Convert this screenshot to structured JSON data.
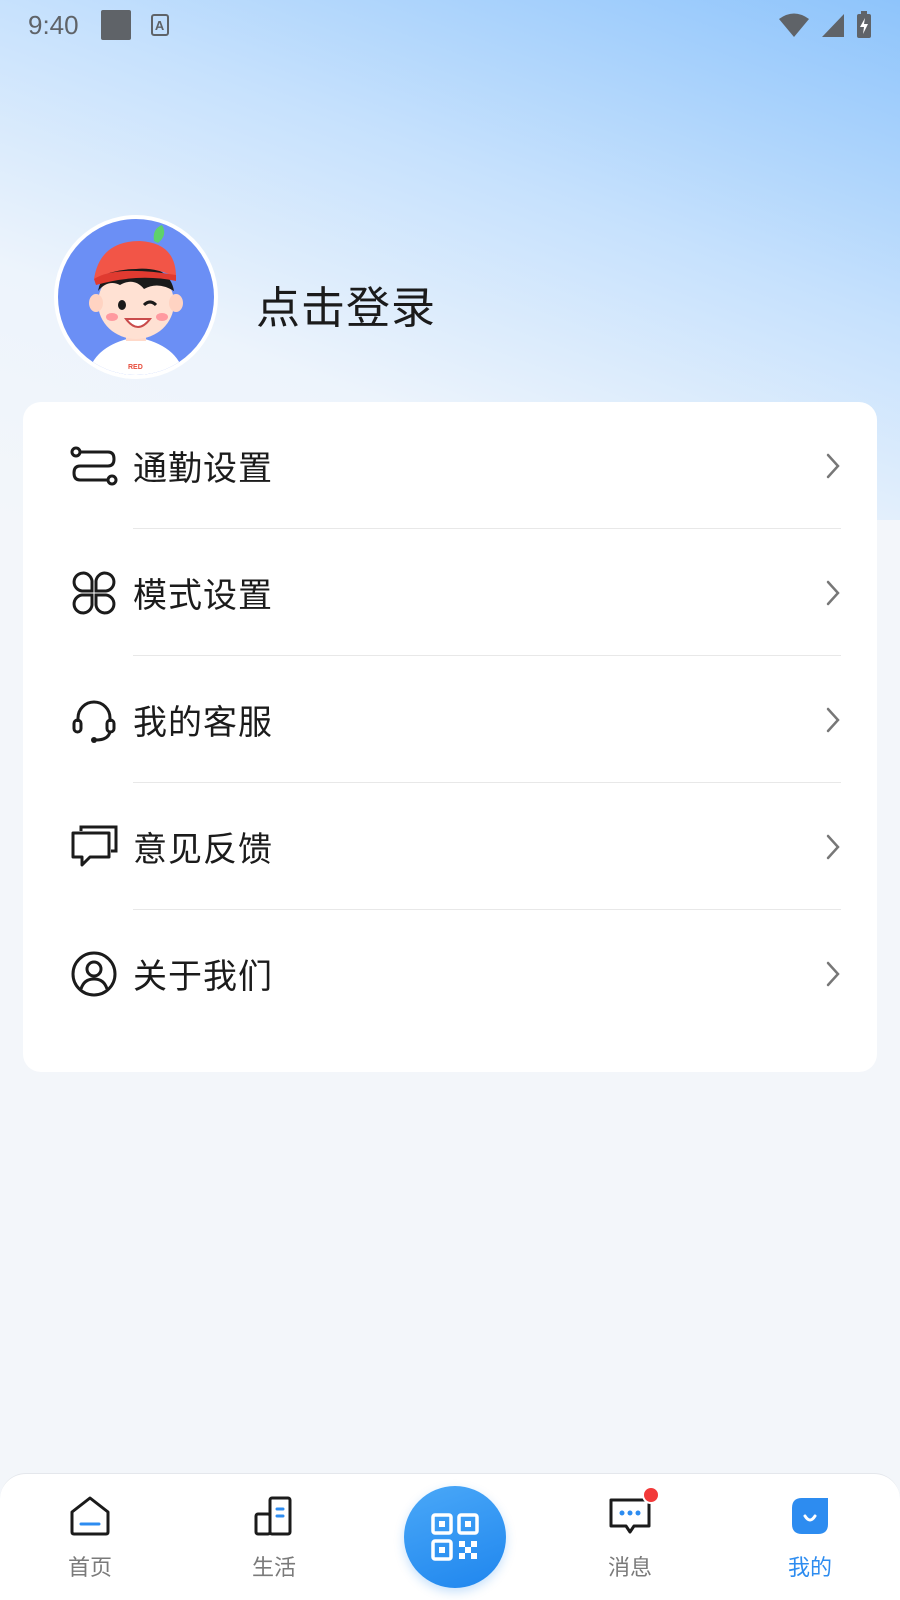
{
  "status_bar": {
    "time": "9:40",
    "indicator_letter": "A"
  },
  "profile": {
    "login_text": "点击登录",
    "avatar_shirt_text": "RED"
  },
  "menu": {
    "items": [
      {
        "label": "通勤设置",
        "icon": "route-icon"
      },
      {
        "label": "模式设置",
        "icon": "mode-grid-icon"
      },
      {
        "label": "我的客服",
        "icon": "headset-icon"
      },
      {
        "label": "意见反馈",
        "icon": "feedback-chat-icon"
      },
      {
        "label": "关于我们",
        "icon": "user-circle-icon"
      }
    ]
  },
  "bottom_nav": {
    "items": [
      {
        "label": "首页",
        "icon": "home-icon",
        "active": false
      },
      {
        "label": "生活",
        "icon": "life-icon",
        "active": false
      },
      {
        "label": "消息",
        "icon": "message-icon",
        "active": false,
        "has_badge": true
      },
      {
        "label": "我的",
        "icon": "profile-icon",
        "active": true
      }
    ],
    "center_button": {
      "icon": "qr-code-icon"
    }
  },
  "colors": {
    "accent": "#2d8cf0",
    "badge": "#f23a3a",
    "avatar_bg": "#6b8ff5"
  }
}
